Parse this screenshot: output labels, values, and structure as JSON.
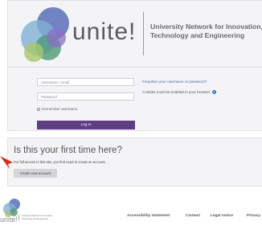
{
  "brand": {
    "wordmark": "unite!",
    "tagline": "University Network for Innovation, Technology and Engineering"
  },
  "login": {
    "username_placeholder": "Username / email",
    "password_placeholder": "Password",
    "remember_label": "Remember username",
    "login_button": "Log in",
    "forgotten_link": "Forgotten your username or password?",
    "cookie_note": "Cookies must be enabled in your browser",
    "help_icon": "question-circle-icon"
  },
  "first_time": {
    "title": "Is this your first time here?",
    "text": "For full access to this site, you first need to create an account.",
    "create_button": "Create new account"
  },
  "footer": {
    "wordmark": "unite!",
    "tagline": "University Network for Innovation, Technology and Engineering",
    "links": [
      "Accessibility statement",
      "Contact",
      "Legal notice",
      "Privacy"
    ]
  },
  "colors": {
    "primary": "#5e3d84",
    "card_bg": "#f4f4f6",
    "arrow": "#d82a1c",
    "link": "#4a6bb5"
  }
}
